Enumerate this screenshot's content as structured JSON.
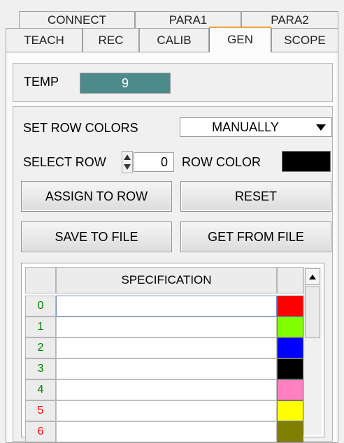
{
  "tabs_row1": [
    {
      "label": "CONNECT"
    },
    {
      "label": "PARA1"
    },
    {
      "label": "PARA2"
    }
  ],
  "tabs_row2": [
    {
      "label": "TEACH"
    },
    {
      "label": "REC"
    },
    {
      "label": "CALIB"
    },
    {
      "label": "GEN",
      "active": true
    },
    {
      "label": "SCOPE"
    }
  ],
  "temp": {
    "label": "TEMP",
    "value": "9",
    "color": "#4d8a8a"
  },
  "row_colors": {
    "label": "SET ROW COLORS",
    "mode": "MANUALLY"
  },
  "select_row": {
    "label": "SELECT ROW",
    "value": "0"
  },
  "row_color": {
    "label": "ROW COLOR",
    "color": "#000000"
  },
  "buttons": {
    "assign": "ASSIGN TO ROW",
    "reset": "RESET",
    "save": "SAVE TO FILE",
    "get": "GET FROM FILE"
  },
  "table": {
    "header": "SPECIFICATION",
    "rows": [
      {
        "num": "0",
        "num_color": "#008000",
        "spec": "",
        "color": "#ff0000"
      },
      {
        "num": "1",
        "num_color": "#008000",
        "spec": "",
        "color": "#80ff00"
      },
      {
        "num": "2",
        "num_color": "#008000",
        "spec": "",
        "color": "#0000ff"
      },
      {
        "num": "3",
        "num_color": "#008000",
        "spec": "",
        "color": "#000000"
      },
      {
        "num": "4",
        "num_color": "#008000",
        "spec": "",
        "color": "#ff80c0"
      },
      {
        "num": "5",
        "num_color": "#ff0000",
        "spec": "",
        "color": "#ffff00"
      },
      {
        "num": "6",
        "num_color": "#ff0000",
        "spec": "",
        "color": "#808000"
      }
    ]
  }
}
